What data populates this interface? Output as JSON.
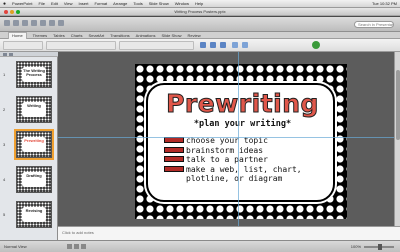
{
  "menubar": {
    "apple": "",
    "items": [
      "PowerPoint",
      "File",
      "Edit",
      "View",
      "Insert",
      "Format",
      "Arrange",
      "Tools",
      "Slide Show",
      "Window",
      "Help"
    ],
    "right": [
      "Tue 10:32 PM"
    ]
  },
  "window": {
    "title": "Writing Process Posters.pptx"
  },
  "toolbar": {
    "search_placeholder": "Search in Presentation"
  },
  "ribbon": {
    "tabs": [
      "Home",
      "Themes",
      "Tables",
      "Charts",
      "SmartArt",
      "Transitions",
      "Animations",
      "Slide Show",
      "Review"
    ],
    "active_tab": "Home"
  },
  "slides_panel": {
    "thumbnails": [
      {
        "number": "1",
        "title": "The Writing Process",
        "selected": false
      },
      {
        "number": "2",
        "title": "Writing",
        "selected": false
      },
      {
        "number": "3",
        "title": "Prewriting",
        "selected": true
      },
      {
        "number": "4",
        "title": "Drafting",
        "selected": false
      },
      {
        "number": "5",
        "title": "Revising",
        "selected": false
      }
    ]
  },
  "slide": {
    "title": "Prewriting",
    "subtitle": "*plan your writing*",
    "bullets": [
      "choose your topic",
      "brainstorm ideas",
      "talk to a partner",
      "make a web, list, chart, plotline, or diagram"
    ]
  },
  "notes": {
    "placeholder": "Click to add notes"
  },
  "statusbar": {
    "slide_info": "Normal View",
    "zoom": "100%"
  }
}
